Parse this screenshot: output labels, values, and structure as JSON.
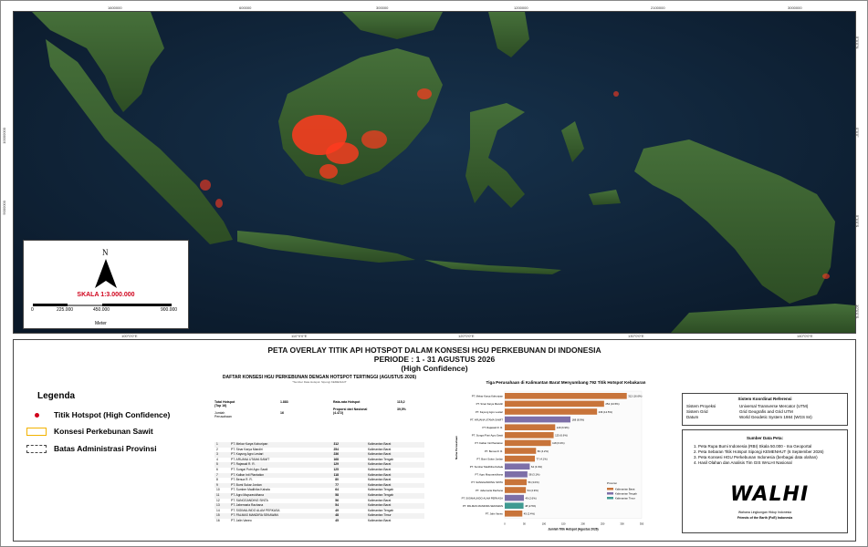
{
  "map": {
    "top_coords": [
      "1600000",
      "600000",
      "300000",
      "1200000",
      "2100000",
      "3000000"
    ],
    "bottom_coords": [
      "100°0'0\"E",
      "110°0'0\"E",
      "120°0'0\"E",
      "130°0'0\"E",
      "140°0'0\"E"
    ],
    "right_coords": [
      "5°0'0\"N",
      "0°0'0\"",
      "5°0'0\"S",
      "10°0'0\"S"
    ],
    "left_coords": [
      "10000000",
      "9000000"
    ],
    "scale": {
      "north": "N",
      "text": "SKALA 1:3.000.000",
      "ticks": [
        "0",
        "225.000",
        "450.000",
        "900.000"
      ],
      "unit": "Meter"
    }
  },
  "title": {
    "line1": "PETA OVERLAY TITIK API HOTSPOT DALAM KONSESI HGU PERKEBUNAN DI INDONESIA",
    "line2": "PERIODE : 1 - 31 AGUSTUS 2026",
    "line3": "(High Confidence)"
  },
  "legend": {
    "title": "Legenda",
    "items": [
      {
        "label": "Titik Hotspot (High Confidence)"
      },
      {
        "label": "Konsesi Perkebunan Sawit"
      },
      {
        "label": "Batas Administrasi Provinsi"
      }
    ]
  },
  "table": {
    "title": "DAFTAR KONSESI HGU PERKEBUNAN DENGAN HOTSPOT TERTINGGI (AGUSTUS 2026)",
    "subtitle": "*Sumber Data Hotspot: Sipongi KEMENHUT",
    "stats_left": [
      {
        "label": "Total Hotspot (Top 16)",
        "value": "1.883"
      },
      {
        "label": "Jumlah Perusahaan",
        "value": "16"
      }
    ],
    "stats_right": [
      {
        "label": "Rata-rata Hotspot",
        "value": "115,2"
      },
      {
        "label": "Proporsi dari Nasional (4.472)",
        "value": "39,5%"
      }
    ],
    "rows": [
      [
        "1",
        "PT. Mekar Karya Kahuripan",
        "312",
        "Kalimantan Barat"
      ],
      [
        "2",
        "PT. Sinar Karya Mandiri",
        "254",
        "Kalimantan Barat"
      ],
      [
        "3",
        "PT. Kayung Agro Lestari",
        "236",
        "Kalimantan Barat"
      ],
      [
        "4",
        "PT. ARUANA UTAMA SAWIT",
        "168",
        "Kalimantan Tengah"
      ],
      [
        "5",
        "PT. Rajawali R. R.",
        "129",
        "Kalimantan Barat"
      ],
      [
        "6",
        "PT. Sungai Putri Agro Sawit",
        "125",
        "Kalimantan Barat"
      ],
      [
        "7",
        "PT. Kalbar Inti Plantation",
        "118",
        "Kalimantan Barat"
      ],
      [
        "8",
        "PT. Benua R. R.",
        "80",
        "Kalimantan Barat"
      ],
      [
        "9",
        "PT. Bumi Sukar Jordan",
        "77",
        "Kalimantan Barat"
      ],
      [
        "10",
        "PT. Sumber Madihiba Kahala",
        "64",
        "Kalimantan Tengah"
      ],
      [
        "11",
        "PT. Agro Mayuravidhana",
        "58",
        "Kalimantan Tengah"
      ],
      [
        "12",
        "PT. SANGGANDING SINTA",
        "56",
        "Kalimantan Barat"
      ],
      [
        "13",
        "PT. Jabemaria Rachana",
        "54",
        "Kalimantan Barat"
      ],
      [
        "14",
        "PT. SIGIMALINDO ALAM PERKASA",
        "49",
        "Kalimantan Tengah"
      ],
      [
        "15",
        "PT. PALMAS MANDIRA SEKAWAN",
        "48",
        "Kalimantan Timur"
      ],
      [
        "16",
        "PT. Jalin Vaneo",
        "45",
        "Kalimantan Barat"
      ]
    ]
  },
  "chart_data": {
    "type": "bar",
    "title": "Tiga Perusahaan di Kalimantan Barat Menyumbang 792 Titik Hotspot Kebakaran",
    "xlabel": "Jumlah Titik Hotspot (Agustus 2026)",
    "ylabel": "Nama Perusahaan",
    "categories": [
      "PT. Mekar Karya Kahuripan",
      "PT. Sinar Karya Mandiri",
      "PT. Kayung Agro Lestari",
      "PT. ARUANA UTAMA SAWIT",
      "PT. Rajawali R. R.",
      "PT. Sungai Putri Agro Sawit",
      "PT. Kalbar Inti Plantation",
      "PT. Benua R. R.",
      "PT. Bumi Sukar Jordan",
      "PT. Sumber Madihiba Kahala",
      "PT. Agro Mayuravidhana",
      "PT. SANGGANDING SINTA",
      "PT. Jabemaria Rachana",
      "PT. SIGIMALINDO ALAM PERKASA",
      "PT. PALMAS MANDIRA SEKAWAN",
      "PT. Jalin Vaneo"
    ],
    "values": [
      312,
      254,
      236,
      168,
      129,
      125,
      118,
      80,
      77,
      64,
      58,
      56,
      54,
      49,
      48,
      45
    ],
    "labels": [
      "312 (16.6%)",
      "254 (13.5%)",
      "236 (12.5%)",
      "168 (8.9%)",
      "129 (6.9%)",
      "125 (6.6%)",
      "118 (6.3%)",
      "80 (4.2%)",
      "77 (4.1%)",
      "64 (3.4%)",
      "58 (3.1%)",
      "56 (3.0%)",
      "54 (2.9%)",
      "49 (2.6%)",
      "48 (2.5%)",
      "45 (2.4%)"
    ],
    "regions": [
      "Kalimantan Barat",
      "Kalimantan Barat",
      "Kalimantan Barat",
      "Kalimantan Tengah",
      "Kalimantan Barat",
      "Kalimantan Barat",
      "Kalimantan Barat",
      "Kalimantan Barat",
      "Kalimantan Barat",
      "Kalimantan Tengah",
      "Kalimantan Tengah",
      "Kalimantan Barat",
      "Kalimantan Barat",
      "Kalimantan Tengah",
      "Kalimantan Timur",
      "Kalimantan Barat"
    ],
    "legend_title": "Provinsi",
    "legend": [
      {
        "name": "Kalimantan Barat",
        "color": "#c8743a"
      },
      {
        "name": "Kalimantan Tengah",
        "color": "#7d6fa8"
      },
      {
        "name": "Kalimantan Timur",
        "color": "#3f9a92"
      }
    ],
    "xlim": [
      0,
      350
    ]
  },
  "reference": {
    "title": "Sistem Koordinat Referensi",
    "rows": [
      [
        "Sistem Proyeksi",
        "Universal Transverse Mercator (UTM)"
      ],
      [
        "Sistem Grid",
        "Grid Geografis and Grid UTM"
      ],
      [
        "Datum",
        "World Geodetic System 1984 (WGS 84)"
      ]
    ]
  },
  "sources": {
    "title": "Sumber Data Peta:",
    "items": [
      "1. Peta Rupa Bumi Indonesia (RBI) Skala 50.000 - Ina Geoportal",
      "2. Peta Sebaran Titik Hotspot Sipongi KEMENHUT (6 September 2026)",
      "3. Peta Konsesi HGU Perkebunan Indonesia (berbagai data olahan)",
      "4. Hasil Olahan dan Analisis Tim GIS WALHI Nasional"
    ],
    "logo": "WALHI",
    "org1": "Wahana Lingkungan Hidup Indonesia",
    "org2": "Friends of the Earth (FoE) Indonesia"
  },
  "colors": {
    "sea": "#0d1f33",
    "land": "#3a5e2a",
    "hotspot": "#ff3b1f",
    "scale_red": "#d0021b"
  }
}
